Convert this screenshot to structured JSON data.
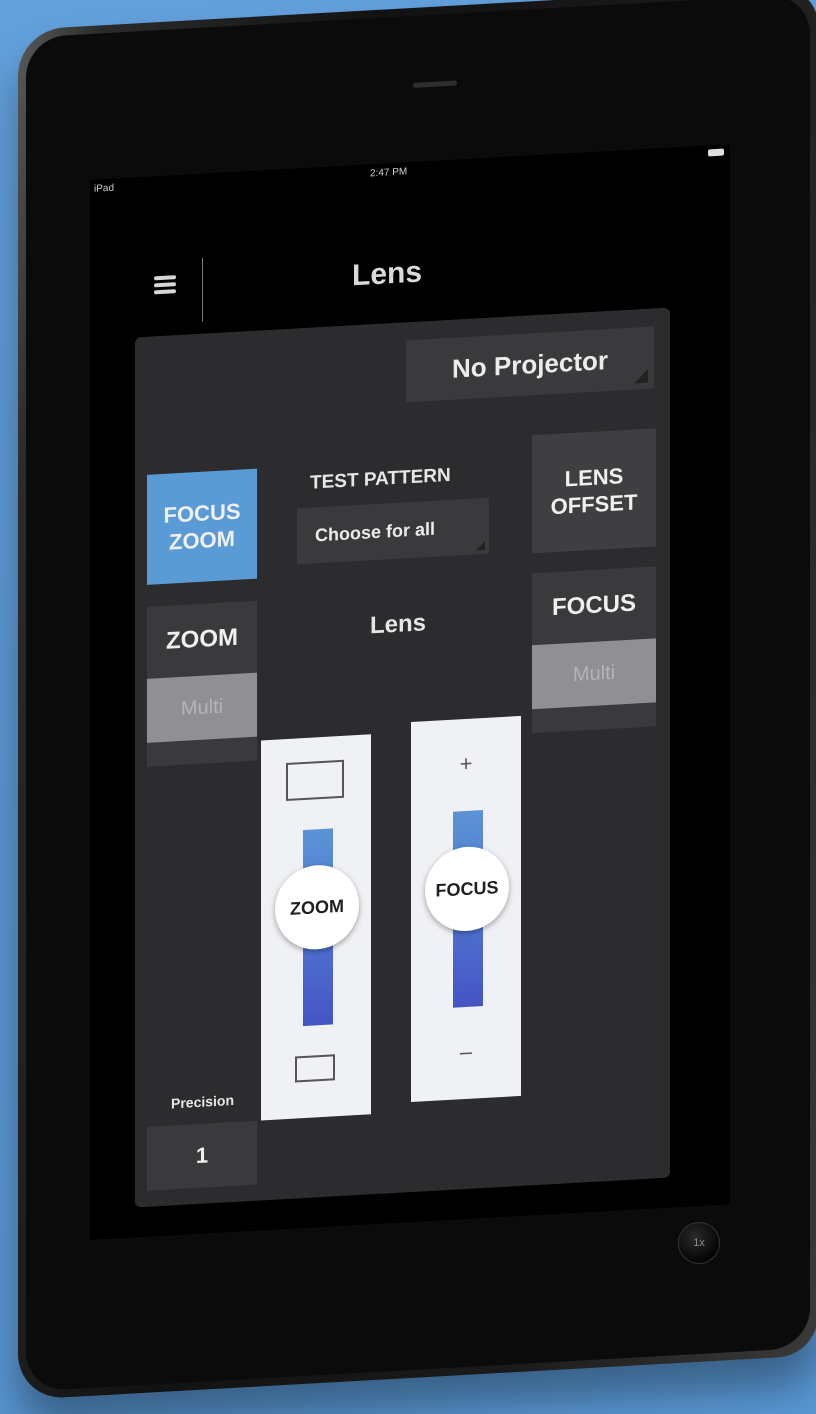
{
  "status_bar": {
    "device": "iPad",
    "time": "2:47 PM"
  },
  "header": {
    "title": "Lens"
  },
  "projector_select": {
    "value": "No Projector"
  },
  "buttons": {
    "focus_zoom": "FOCUS ZOOM",
    "lens_offset": "LENS OFFSET"
  },
  "test_pattern": {
    "label": "TEST PATTERN",
    "value": "Choose for all"
  },
  "zoom_group": {
    "title": "ZOOM",
    "multi": "Multi"
  },
  "focus_group": {
    "title": "FOCUS",
    "multi": "Multi"
  },
  "center_label": "Lens",
  "sliders": {
    "zoom_knob": "ZOOM",
    "focus_knob": "FOCUS",
    "focus_plus": "+",
    "focus_minus": "–"
  },
  "precision": {
    "label": "Precision",
    "value": "1"
  },
  "home_badge": "1x",
  "colors": {
    "accent": "#5b9bd5",
    "panel": "#2c2c2e",
    "background": "#5d9bd8"
  }
}
